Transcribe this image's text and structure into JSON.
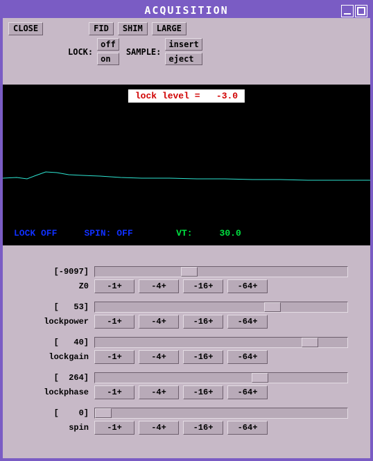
{
  "window": {
    "title": "ACQUISITION"
  },
  "toolbar": {
    "close": "CLOSE",
    "fid": "FID",
    "shim": "SHIM",
    "large": "LARGE"
  },
  "controls": {
    "lock_label": "LOCK:",
    "sample_label": "SAMPLE:",
    "lock_off": "off",
    "lock_on": "on",
    "sample_insert": "insert",
    "sample_eject": "eject"
  },
  "display": {
    "lock_level_label": "lock level =   -3.0",
    "status_lock": "LOCK OFF",
    "status_spin": "SPIN: OFF",
    "status_vt_label": "VT:",
    "status_vt_value": "30.0"
  },
  "steps": {
    "s1": "-1+",
    "s4": "-4+",
    "s16": "-16+",
    "s64": "-64+"
  },
  "params": [
    {
      "name": "Z0",
      "value": "[-9097]",
      "thumb_pct": 37
    },
    {
      "name": "lockpower",
      "value": "[   53]",
      "thumb_pct": 70
    },
    {
      "name": "lockgain",
      "value": "[   40]",
      "thumb_pct": 85
    },
    {
      "name": "lockphase",
      "value": "[  264]",
      "thumb_pct": 65
    },
    {
      "name": "spin",
      "value": "[    0]",
      "thumb_pct": 0
    }
  ]
}
